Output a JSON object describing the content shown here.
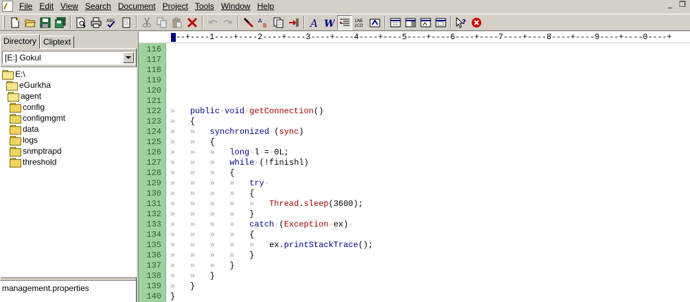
{
  "menu": {
    "items": [
      {
        "label": "File"
      },
      {
        "label": "Edit"
      },
      {
        "label": "View"
      },
      {
        "label": "Search"
      },
      {
        "label": "Document"
      },
      {
        "label": "Project"
      },
      {
        "label": "Tools"
      },
      {
        "label": "Window"
      },
      {
        "label": "Help"
      }
    ]
  },
  "toolbar": {
    "buttons": [
      "new-file",
      "open-folder",
      "save",
      "save-all",
      "sep",
      "print-preview",
      "print",
      "spell-check",
      "toggle-view",
      "sep",
      "cut",
      "copy",
      "paste",
      "delete",
      "sep",
      "undo",
      "redo",
      "sep",
      "find",
      "replace",
      "find-in-files",
      "goto",
      "sep",
      "font",
      "word-wrap",
      "active-tab-toggle",
      "columns",
      "properties",
      "sep",
      "panel-1",
      "panel-2",
      "panel-3",
      "panel-4",
      "sep",
      "context-help",
      "stop"
    ]
  },
  "left_pane": {
    "tabs": [
      {
        "label": "Directory",
        "active": true
      },
      {
        "label": "Cliptext",
        "active": false
      }
    ],
    "drive": "[E:] Gokul",
    "tree": [
      {
        "label": "E:\\",
        "depth": 0,
        "open": true
      },
      {
        "label": "eGurkha",
        "depth": 1,
        "open": true
      },
      {
        "label": "agent",
        "depth": 2,
        "open": true
      },
      {
        "label": "config",
        "depth": 3,
        "open": false
      },
      {
        "label": "configmgmt",
        "depth": 3,
        "open": false
      },
      {
        "label": "data",
        "depth": 3,
        "open": false
      },
      {
        "label": "logs",
        "depth": 3,
        "open": false
      },
      {
        "label": "snmptrapd",
        "depth": 3,
        "open": false
      },
      {
        "label": "threshold",
        "depth": 3,
        "open": false
      }
    ],
    "files": [
      "management.properties"
    ]
  },
  "editor": {
    "ruler": "---+----1----+----2----+----3----+----4----+----5----+----6----+----7----+----8----+----9----+----0----+",
    "lines": [
      {
        "n": "116",
        "indent": 0,
        "tokens": []
      },
      {
        "n": "117",
        "indent": 0,
        "tokens": []
      },
      {
        "n": "118",
        "indent": 0,
        "tokens": []
      },
      {
        "n": "119",
        "indent": 0,
        "tokens": []
      },
      {
        "n": "120",
        "indent": 0,
        "tokens": []
      },
      {
        "n": "121",
        "indent": 0,
        "tokens": []
      },
      {
        "n": "122",
        "indent": 1,
        "tokens": [
          [
            "kw",
            "public"
          ],
          [
            "ws",
            "·"
          ],
          [
            "kw",
            "void"
          ],
          [
            "ws",
            "·"
          ],
          [
            "fn",
            "getConnection"
          ],
          [
            "t",
            "()"
          ]
        ]
      },
      {
        "n": "123",
        "indent": 1,
        "tokens": [
          [
            "t",
            "{"
          ]
        ]
      },
      {
        "n": "124",
        "indent": 2,
        "tokens": [
          [
            "kw",
            "synchronized"
          ],
          [
            "ws",
            "·"
          ],
          [
            "t",
            "("
          ],
          [
            "fn",
            "sync"
          ],
          [
            "t",
            ")"
          ]
        ]
      },
      {
        "n": "125",
        "indent": 2,
        "tokens": [
          [
            "t",
            "{"
          ]
        ]
      },
      {
        "n": "126",
        "indent": 3,
        "tokens": [
          [
            "kw",
            "long"
          ],
          [
            "ws",
            "·"
          ],
          [
            "t",
            "l"
          ],
          [
            "ws",
            "·"
          ],
          [
            "t",
            "="
          ],
          [
            "ws",
            "·"
          ],
          [
            "t",
            "0L;"
          ]
        ]
      },
      {
        "n": "127",
        "indent": 3,
        "tokens": [
          [
            "kw",
            "while"
          ],
          [
            "ws",
            "·"
          ],
          [
            "t",
            "(!finishl)"
          ]
        ]
      },
      {
        "n": "128",
        "indent": 3,
        "tokens": [
          [
            "t",
            "{"
          ]
        ]
      },
      {
        "n": "129",
        "indent": 4,
        "tokens": [
          [
            "kw",
            "try"
          ],
          [
            "ws",
            "·"
          ]
        ]
      },
      {
        "n": "130",
        "indent": 4,
        "tokens": [
          [
            "t",
            "{"
          ]
        ]
      },
      {
        "n": "131",
        "indent": 5,
        "tokens": [
          [
            "fn",
            "Thread"
          ],
          [
            "t",
            "."
          ],
          [
            "fn",
            "sleep"
          ],
          [
            "t",
            "(3600);"
          ]
        ]
      },
      {
        "n": "132",
        "indent": 4,
        "tokens": [
          [
            "t",
            "}"
          ]
        ]
      },
      {
        "n": "133",
        "indent": 4,
        "tokens": [
          [
            "kw",
            "catch"
          ],
          [
            "ws",
            "·"
          ],
          [
            "t",
            "("
          ],
          [
            "fn",
            "Exception"
          ],
          [
            "ws",
            "·"
          ],
          [
            "t",
            "ex)"
          ],
          [
            "ws",
            "·"
          ]
        ]
      },
      {
        "n": "134",
        "indent": 4,
        "tokens": [
          [
            "t",
            "{"
          ]
        ]
      },
      {
        "n": "135",
        "indent": 5,
        "tokens": [
          [
            "t",
            "ex."
          ],
          [
            "kw",
            "printStackTrace"
          ],
          [
            "t",
            "();"
          ]
        ]
      },
      {
        "n": "136",
        "indent": 4,
        "tokens": [
          [
            "t",
            "}"
          ]
        ]
      },
      {
        "n": "137",
        "indent": 3,
        "tokens": [
          [
            "t",
            "}"
          ]
        ]
      },
      {
        "n": "138",
        "indent": 2,
        "tokens": [
          [
            "t",
            "}"
          ]
        ]
      },
      {
        "n": "139",
        "indent": 1,
        "tokens": [
          [
            "t",
            "}"
          ]
        ]
      },
      {
        "n": "140",
        "indent": 0,
        "tokens": [
          [
            "t",
            "}"
          ]
        ]
      }
    ]
  },
  "window_controls": {
    "minimize": "_",
    "restore": "❐"
  }
}
